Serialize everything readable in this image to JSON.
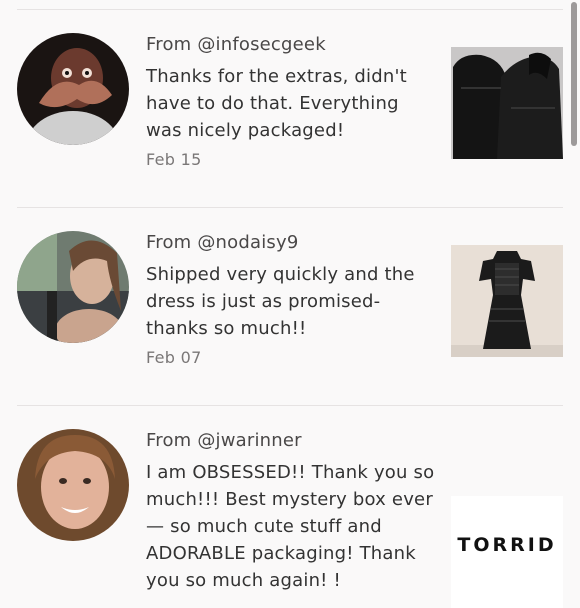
{
  "reviews": [
    {
      "from": "From @infosecgeek",
      "text": "Thanks for the extras, didn't have to do that. Everything was nicely packaged!",
      "date": "Feb 15",
      "avatar_icon": "user-avatar-photo",
      "thumb_icon": "black-jackets-photo"
    },
    {
      "from": "From @nodaisy9",
      "text": "Shipped very quickly and the dress is just as promised- thanks so much!!",
      "date": "Feb 07",
      "avatar_icon": "user-avatar-photo",
      "thumb_icon": "black-lace-dress-photo"
    },
    {
      "from": "From @jwarinner",
      "text": "I am OBSESSED!! Thank you so much!!! Best mystery box ever— so much cute stuff and ADORABLE packaging! Thank you so much again! !",
      "date": "",
      "avatar_icon": "user-avatar-photo",
      "thumb_text": "TORRID"
    }
  ],
  "colors": {
    "background": "#faf9f9",
    "divider": "#e6e3e3",
    "text": "#333333",
    "muted": "#7a7777"
  }
}
